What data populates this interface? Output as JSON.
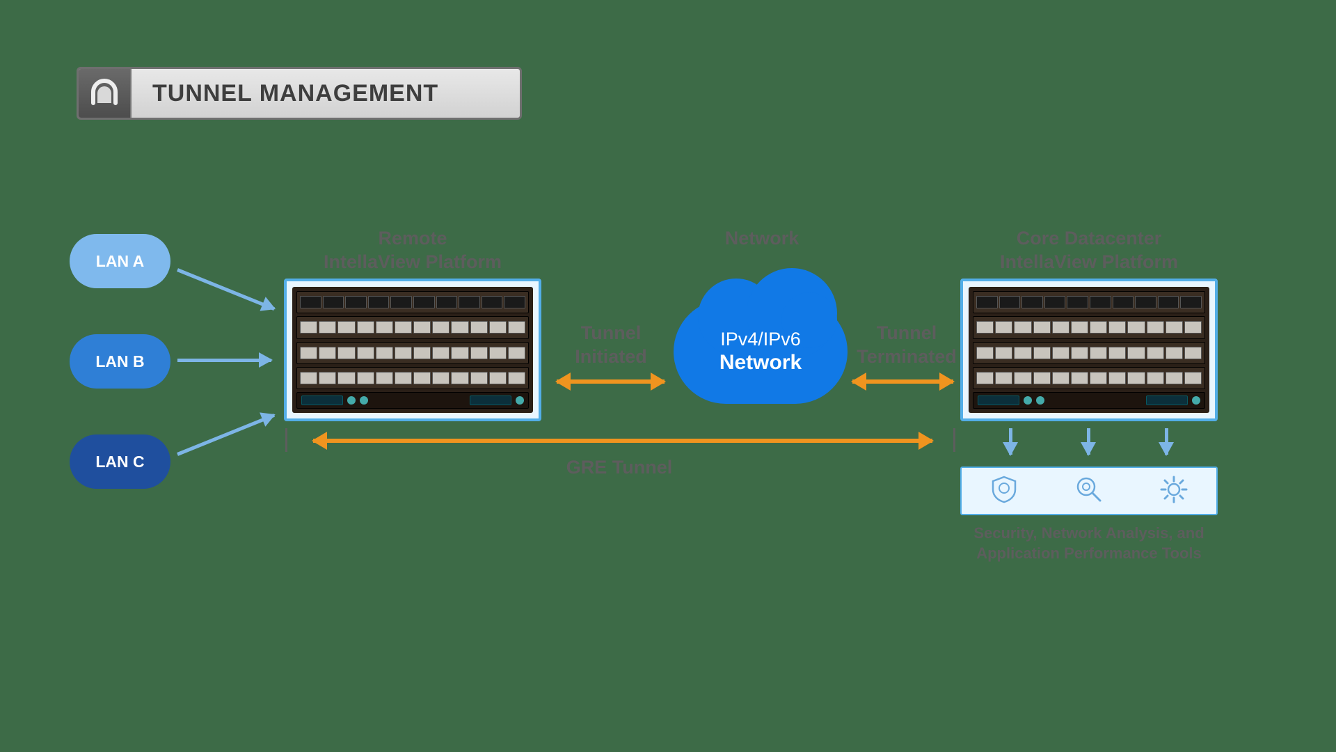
{
  "title": "TUNNEL MANAGEMENT",
  "lan": {
    "a": "LAN A",
    "b": "LAN B",
    "c": "LAN C"
  },
  "labels": {
    "remote_line1": "Remote",
    "remote_line2": "IntellaView Platform",
    "network_header": "Network",
    "core_line1": "Core Datacenter",
    "core_line2": "IntellaView Platform",
    "tunnel_initiated_l1": "Tunnel",
    "tunnel_initiated_l2": "Initiated",
    "tunnel_terminated_l1": "Tunnel",
    "tunnel_terminated_l2": "Terminated",
    "gre": "GRE Tunnel",
    "tools_l1": "Security, Network Analysis, and",
    "tools_l2": "Application Performance Tools"
  },
  "network_cloud": {
    "line1": "IPv4/IPv6",
    "line2": "Network"
  }
}
